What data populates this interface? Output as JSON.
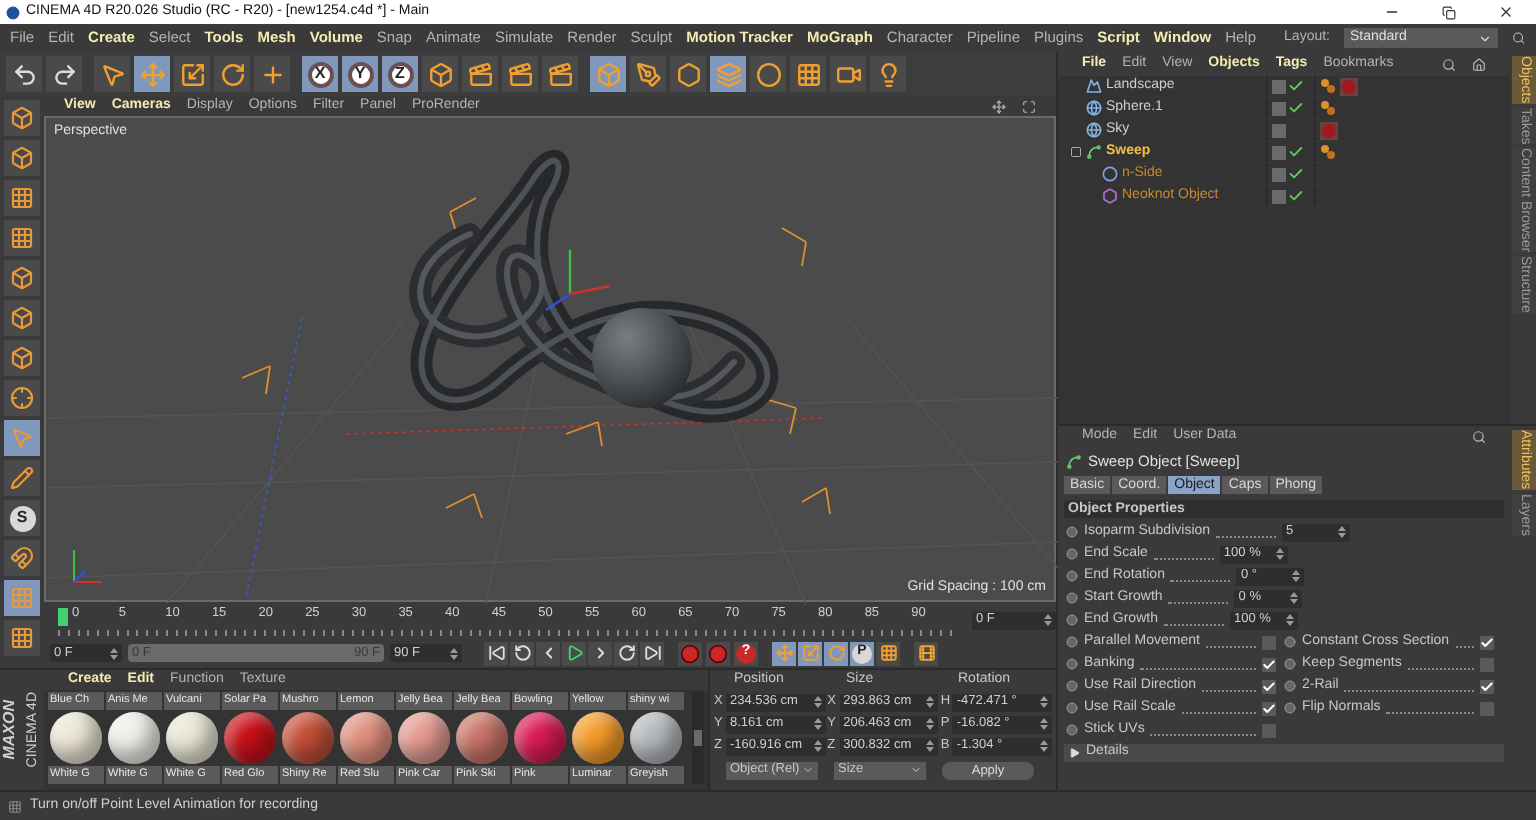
{
  "window": {
    "title": "CINEMA 4D R20.026 Studio (RC - R20) - [new1254.c4d *] - Main"
  },
  "menu": [
    {
      "label": "File",
      "emphasized": false
    },
    {
      "label": "Edit",
      "emphasized": false
    },
    {
      "label": "Create",
      "emphasized": true
    },
    {
      "label": "Select",
      "emphasized": false
    },
    {
      "label": "Tools",
      "emphasized": true
    },
    {
      "label": "Mesh",
      "emphasized": true
    },
    {
      "label": "Volume",
      "emphasized": true
    },
    {
      "label": "Snap",
      "emphasized": false
    },
    {
      "label": "Animate",
      "emphasized": false
    },
    {
      "label": "Simulate",
      "emphasized": false
    },
    {
      "label": "Render",
      "emphasized": false
    },
    {
      "label": "Sculpt",
      "emphasized": false
    },
    {
      "label": "Motion Tracker",
      "emphasized": true
    },
    {
      "label": "MoGraph",
      "emphasized": true
    },
    {
      "label": "Character",
      "emphasized": false
    },
    {
      "label": "Pipeline",
      "emphasized": false
    },
    {
      "label": "Plugins",
      "emphasized": false
    },
    {
      "label": "Script",
      "emphasized": true
    },
    {
      "label": "Window",
      "emphasized": true
    },
    {
      "label": "Help",
      "emphasized": false
    }
  ],
  "layout": {
    "label": "Layout:",
    "value": "Standard"
  },
  "toolbar": [
    {
      "kind": "undo",
      "selected": false
    },
    {
      "kind": "redo",
      "selected": false
    },
    {
      "kind": "select",
      "selected": false
    },
    {
      "kind": "move",
      "selected": true
    },
    {
      "kind": "scale",
      "selected": false
    },
    {
      "kind": "rotate",
      "selected": false
    },
    {
      "kind": "add",
      "selected": false
    },
    {
      "kind": "axis",
      "label": "X",
      "selected": true
    },
    {
      "kind": "axis",
      "label": "Y",
      "selected": true
    },
    {
      "kind": "axis",
      "label": "Z",
      "selected": true
    },
    {
      "kind": "coord",
      "selected": false
    },
    {
      "kind": "render-view",
      "selected": false
    },
    {
      "kind": "render",
      "selected": false
    },
    {
      "kind": "render-settings",
      "selected": false
    },
    {
      "kind": "cube",
      "selected": true
    },
    {
      "kind": "pen",
      "selected": false
    },
    {
      "kind": "subdivide",
      "selected": false
    },
    {
      "kind": "generator",
      "selected": true
    },
    {
      "kind": "deformer",
      "selected": false
    },
    {
      "kind": "floor",
      "selected": false
    },
    {
      "kind": "camera",
      "selected": false
    },
    {
      "kind": "light",
      "selected": false
    }
  ],
  "left_toolbar": [
    {
      "kind": "make-editable",
      "selected": false
    },
    {
      "kind": "model",
      "selected": false
    },
    {
      "kind": "texture",
      "selected": false
    },
    {
      "kind": "workplane",
      "selected": false
    },
    {
      "kind": "points",
      "selected": false
    },
    {
      "kind": "edges",
      "selected": false
    },
    {
      "kind": "polygons",
      "selected": false
    },
    {
      "kind": "axis",
      "selected": false
    },
    {
      "kind": "tweak",
      "selected": true
    },
    {
      "kind": "soft",
      "selected": false
    },
    {
      "kind": "snap",
      "label": "S",
      "selected": false
    },
    {
      "kind": "magnet",
      "selected": false
    },
    {
      "kind": "point-animation",
      "selected": true
    },
    {
      "kind": "param-animation",
      "selected": false
    }
  ],
  "viewport": {
    "menu": [
      {
        "label": "View",
        "emphasized": true
      },
      {
        "label": "Cameras",
        "emphasized": true
      },
      {
        "label": "Display",
        "emphasized": false
      },
      {
        "label": "Options",
        "emphasized": false
      },
      {
        "label": "Filter",
        "emphasized": false
      },
      {
        "label": "Panel",
        "emphasized": false
      },
      {
        "label": "ProRender",
        "emphasized": false
      }
    ],
    "camera": "Perspective",
    "grid_spacing": "Grid Spacing : 100 cm"
  },
  "timeline": {
    "ticks": [
      "0",
      "5",
      "10",
      "15",
      "20",
      "25",
      "30",
      "35",
      "40",
      "45",
      "50",
      "55",
      "60",
      "65",
      "70",
      "75",
      "80",
      "85",
      "90"
    ],
    "playhead": {
      "level": 0
    },
    "current_frame": "0 F"
  },
  "playback": {
    "start": "0 F",
    "range_start": "0 F",
    "range_end": "90 F",
    "end": "90 F",
    "range": {
      "level": 1
    },
    "buttons": [
      {
        "kind": "first"
      },
      {
        "kind": "prev-key"
      },
      {
        "kind": "prev-frame"
      },
      {
        "kind": "play"
      },
      {
        "kind": "next-frame"
      },
      {
        "kind": "next-key"
      },
      {
        "kind": "last"
      }
    ],
    "record_buttons": [
      {
        "kind": "record"
      },
      {
        "kind": "autokey"
      },
      {
        "kind": "help",
        "label": "?"
      }
    ],
    "key_buttons": [
      {
        "kind": "key-move",
        "selected": true
      },
      {
        "kind": "key-scale",
        "selected": true
      },
      {
        "kind": "key-rotate",
        "selected": true
      },
      {
        "kind": "key-param",
        "label": "P",
        "selected": true
      },
      {
        "kind": "key-points",
        "selected": false
      },
      {
        "kind": "timeline",
        "selected": false
      }
    ]
  },
  "logo": {
    "brand": "MAXON",
    "product": "CINEMA 4D"
  },
  "materials": {
    "menu": [
      {
        "label": "Create",
        "emphasized": true
      },
      {
        "label": "Edit",
        "emphasized": true
      },
      {
        "label": "Function",
        "emphasized": false
      },
      {
        "label": "Texture",
        "emphasized": false
      }
    ],
    "row_1": [
      "Blue Ch",
      "Anis Me",
      "Vulcani",
      "Solar Pa",
      "Mushro",
      "Lemon",
      "Jelly Bea",
      "Jelly Bea",
      "Bowling",
      "Yellow",
      "shiny wi"
    ],
    "row_2": [
      {
        "name": "White G",
        "color": "#ece6d6"
      },
      {
        "name": "White G",
        "color": "#efefe9"
      },
      {
        "name": "White G",
        "color": "#eae7d6"
      },
      {
        "name": "Red Glo",
        "color": "#c8101a"
      },
      {
        "name": "Shiny Re",
        "color": "#c45038"
      },
      {
        "name": "Red Slu",
        "color": "#e0907e"
      },
      {
        "name": "Pink Car",
        "color": "#e49a92"
      },
      {
        "name": "Pink Ski",
        "color": "#c87468"
      },
      {
        "name": "Pink",
        "color": "#d81c54"
      },
      {
        "name": "Luminar",
        "color": "#f49a2a"
      },
      {
        "name": "Greyish",
        "color": "#b4b8bc"
      }
    ]
  },
  "coordinates": {
    "headers": [
      "Position",
      "Size",
      "Rotation"
    ],
    "rows": [
      {
        "axis": "X",
        "position": "234.536 cm",
        "size_axis": "X",
        "size": "293.863 cm",
        "rotation_axis": "H",
        "rotation": "-472.471 °"
      },
      {
        "axis": "Y",
        "position": "8.161 cm",
        "size_axis": "Y",
        "size": "206.463 cm",
        "rotation_axis": "P",
        "rotation": "-16.082 °"
      },
      {
        "axis": "Z",
        "position": "-160.916 cm",
        "size_axis": "Z",
        "size": "300.832 cm",
        "rotation_axis": "B",
        "rotation": "-1.304 °"
      }
    ],
    "mode": "Object (Rel)",
    "size_mode": "Size",
    "apply": "Apply"
  },
  "objects": {
    "menu": [
      {
        "label": "File",
        "emphasized": true
      },
      {
        "label": "Edit",
        "emphasized": false
      },
      {
        "label": "View",
        "emphasized": false
      },
      {
        "label": "Objects",
        "emphasized": true
      },
      {
        "label": "Tags",
        "emphasized": true
      },
      {
        "label": "Bookmarks",
        "emphasized": false
      }
    ],
    "items": [
      {
        "name": "Landscape",
        "kind": "landscape",
        "selected": false,
        "enabled": true,
        "tags": [
          {
            "kind": "phong"
          },
          {
            "kind": "material"
          }
        ]
      },
      {
        "name": "Sphere.1",
        "kind": "sphere",
        "selected": false,
        "enabled": true,
        "tags": [
          {
            "kind": "phong"
          }
        ]
      },
      {
        "name": "Sky",
        "kind": "sky",
        "selected": false,
        "enabled": false,
        "tags": [
          {
            "kind": "material"
          }
        ]
      },
      {
        "name": "Sweep",
        "kind": "sweep",
        "selected": true,
        "enabled": true,
        "tags": [
          {
            "kind": "phong"
          }
        ],
        "children": [
          {
            "name": "n-Side",
            "kind": "nside",
            "selected": true,
            "enabled": true
          },
          {
            "name": "Neoknot Object",
            "kind": "neoknot",
            "selected": true,
            "enabled": true
          }
        ]
      }
    ]
  },
  "objects_tabs": [
    {
      "label": "Objects",
      "selected": true
    },
    {
      "label": "Takes",
      "selected": false
    },
    {
      "label": "Content Browser",
      "selected": false
    },
    {
      "label": "Structure",
      "selected": false
    }
  ],
  "attributes": {
    "menu": [
      {
        "label": "Mode",
        "emphasized": false
      },
      {
        "label": "Edit",
        "emphasized": false
      },
      {
        "label": "User Data",
        "emphasized": false
      }
    ],
    "title": "Sweep Object [Sweep]",
    "tabs": [
      {
        "label": "Basic",
        "selected": false
      },
      {
        "label": "Coord.",
        "selected": false
      },
      {
        "label": "Object",
        "selected": true
      },
      {
        "label": "Caps",
        "selected": false
      },
      {
        "label": "Phong",
        "selected": false
      }
    ],
    "section": "Object Properties",
    "fields": [
      {
        "label": "Isoparm Subdivision",
        "value": "5"
      },
      {
        "label": "End Scale",
        "value": "100 %"
      },
      {
        "label": "End Rotation",
        "value": "0 °"
      },
      {
        "label": "Start Growth",
        "value": "0 %"
      },
      {
        "label": "End Growth",
        "value": "100 %"
      }
    ],
    "checkboxes": [
      {
        "label": "Parallel Movement",
        "checked": false
      },
      {
        "label": "Constant Cross Section",
        "checked": true
      },
      {
        "label": "Banking",
        "checked": true
      },
      {
        "label": "Keep Segments",
        "checked": false
      },
      {
        "label": "Use Rail Direction",
        "checked": true
      },
      {
        "label": "2-Rail",
        "checked": true
      },
      {
        "label": "Use Rail Scale",
        "checked": true
      },
      {
        "label": "Flip Normals",
        "checked": false
      },
      {
        "label": "Stick UVs",
        "checked": false
      }
    ],
    "details": {
      "label": "Details",
      "expanded": false
    }
  },
  "attributes_tabs": [
    {
      "label": "Attributes",
      "selected": true
    },
    {
      "label": "Layers",
      "selected": false
    }
  ],
  "status_bar": "Turn on/off Point Level Animation for recording"
}
